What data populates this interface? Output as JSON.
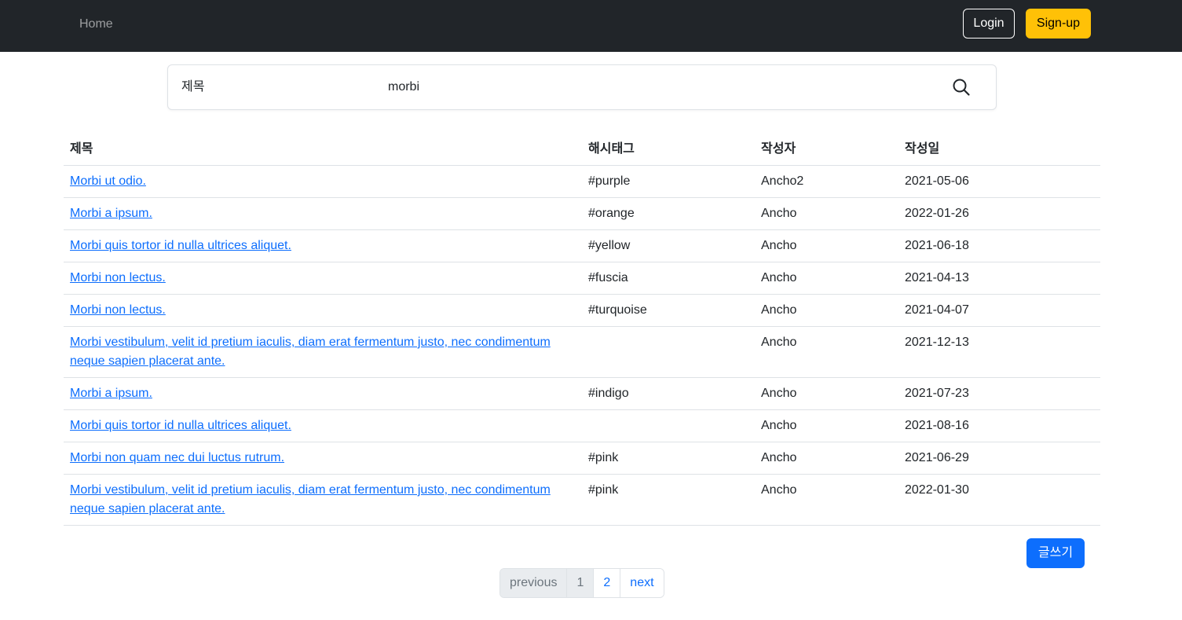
{
  "nav": {
    "home_label": "Home",
    "login_label": "Login",
    "signup_label": "Sign-up"
  },
  "search": {
    "type_label": "제목",
    "value": "morbi",
    "icon": "search-icon"
  },
  "table": {
    "headers": [
      "제목",
      "해시태그",
      "작성자",
      "작성일"
    ],
    "rows": [
      {
        "title": "Morbi ut odio.",
        "hashtag": "#purple",
        "author": "Ancho2",
        "date": "2021-05-06"
      },
      {
        "title": "Morbi a ipsum.",
        "hashtag": "#orange",
        "author": "Ancho",
        "date": "2022-01-26"
      },
      {
        "title": "Morbi quis tortor id nulla ultrices aliquet.",
        "hashtag": "#yellow",
        "author": "Ancho",
        "date": "2021-06-18"
      },
      {
        "title": "Morbi non lectus.",
        "hashtag": "#fuscia",
        "author": "Ancho",
        "date": "2021-04-13"
      },
      {
        "title": "Morbi non lectus.",
        "hashtag": "#turquoise",
        "author": "Ancho",
        "date": "2021-04-07"
      },
      {
        "title": "Morbi vestibulum, velit id pretium iaculis, diam erat fermentum justo, nec condimentum neque sapien placerat ante.",
        "hashtag": "",
        "author": "Ancho",
        "date": "2021-12-13"
      },
      {
        "title": "Morbi a ipsum.",
        "hashtag": "#indigo",
        "author": "Ancho",
        "date": "2021-07-23"
      },
      {
        "title": "Morbi quis tortor id nulla ultrices aliquet.",
        "hashtag": "",
        "author": "Ancho",
        "date": "2021-08-16"
      },
      {
        "title": "Morbi non quam nec dui luctus rutrum.",
        "hashtag": "#pink",
        "author": "Ancho",
        "date": "2021-06-29"
      },
      {
        "title": "Morbi vestibulum, velit id pretium iaculis, diam erat fermentum justo, nec condimentum neque sapien placerat ante.",
        "hashtag": "#pink",
        "author": "Ancho",
        "date": "2022-01-30"
      }
    ]
  },
  "write_button_label": "글쓰기",
  "pagination": {
    "previous_label": "previous",
    "pages": [
      "1",
      "2"
    ],
    "current_page": "1",
    "next_label": "next"
  },
  "colors": {
    "navbar_bg": "#212529",
    "primary": "#0d6efd",
    "warning": "#ffc107"
  }
}
